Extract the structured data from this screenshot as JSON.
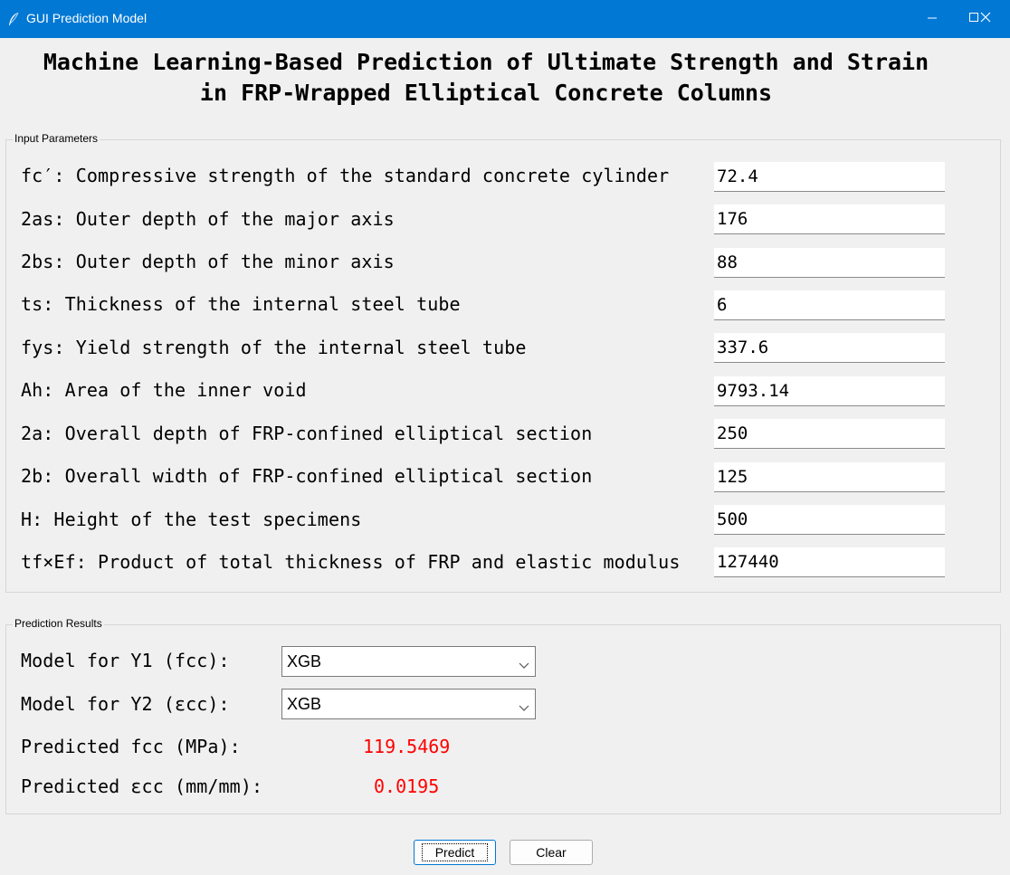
{
  "window": {
    "title": "GUI Prediction Model",
    "controls": {
      "minimize_icon": "minimize-icon",
      "maximize_icon": "maximize-icon",
      "close_icon": "close-icon"
    },
    "titlebar_color": "#0078d4"
  },
  "heading": {
    "line1": "Machine Learning-Based Prediction of Ultimate Strength and Strain",
    "line2": "in FRP-Wrapped Elliptical Concrete Columns"
  },
  "inputs": {
    "frame_label": "Input Parameters",
    "rows": [
      {
        "label": "fc′: Compressive strength of the standard concrete cylinder",
        "value": "72.4"
      },
      {
        "label": "2as: Outer depth of the major axis",
        "value": "176"
      },
      {
        "label": "2bs: Outer depth of the minor axis",
        "value": "88"
      },
      {
        "label": "ts: Thickness of the internal steel tube",
        "value": "6"
      },
      {
        "label": "fys: Yield strength of the internal steel tube",
        "value": "337.6"
      },
      {
        "label": "Ah: Area of the inner void",
        "value": "9793.14"
      },
      {
        "label": "2a: Overall depth of FRP-confined elliptical section",
        "value": "250"
      },
      {
        "label": "2b: Overall width of FRP-confined elliptical section",
        "value": "125"
      },
      {
        "label": "H: Height of the test specimens",
        "value": "500"
      },
      {
        "label": "tf×Ef: Product of total thickness of FRP and elastic modulus",
        "value": "127440"
      }
    ]
  },
  "results": {
    "frame_label": "Prediction Results",
    "model_y1_label": "Model for Y1 (fcc):",
    "model_y1_value": "XGB",
    "model_y2_label": "Model for Y2 (εcc):",
    "model_y2_value": "XGB",
    "pred_fcc_label": "Predicted fcc (MPa):",
    "pred_fcc_value": "119.5469",
    "pred_ecc_label": "Predicted εcc (mm/mm):",
    "pred_ecc_value": "0.0195",
    "result_color": "#ff0000"
  },
  "buttons": {
    "predict": "Predict",
    "clear": "Clear"
  }
}
